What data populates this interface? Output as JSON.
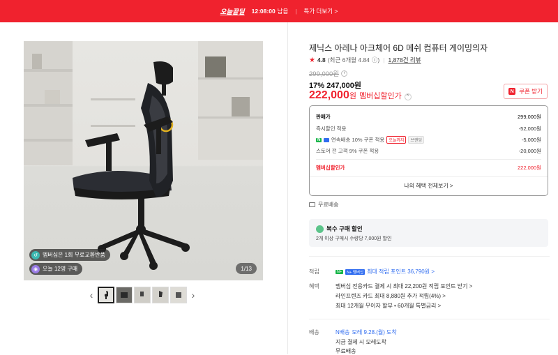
{
  "topbar": {
    "deal_label": "오늘끝딜",
    "time": "12:08:00",
    "remaining": "남음",
    "more": "특가 더보기 >"
  },
  "gallery": {
    "badge_1": "멤버십은 1회 무료교환반품",
    "badge_2": "오늘 12명 구매",
    "counter": "1/13",
    "thumb_count": 5
  },
  "product": {
    "title": "제닉스 아레나 아크체어 6D 메쉬 컴퓨터 게이밍의자",
    "rating": "4.8",
    "recent_rating": "(최근 6개월 4.84",
    "recent_close": ")",
    "reviews": "1,878건 리뷰",
    "original_price": "299,000원",
    "discount": "17%",
    "sale_price": "247,000원",
    "member_price": "222,000",
    "member_price_unit": "원",
    "member_label": "멤버십할인가",
    "coupon_button": "쿠폰 받기"
  },
  "price_box": {
    "head_label": "판매가",
    "head_value": "299,000원",
    "row1_label": "즉시할인 적용",
    "row1_value": "-52,000원",
    "row2_label": "연속배송 10% 쿠폰 적용",
    "row2_tag1": "오늘까지",
    "row2_tag2": "브랜딩",
    "row2_value": "-5,000원",
    "row3_label": "스토어 전 고객 9% 쿠폰 적용",
    "row3_value": "-20,000원",
    "total_label": "멤버십할인가",
    "total_value": "222,000원",
    "all_benefits": "나의 혜택 전체보기 >"
  },
  "shipping_free": "무료배송",
  "multi_buy": {
    "title": "복수 구매 할인",
    "desc": "2개 이상 구매시 수량당 7,000원 할인"
  },
  "points": {
    "label": "적립",
    "badge": "N+ 멤버십",
    "value": "최대 적립 포인트 36,790원 >"
  },
  "benefits": {
    "label": "혜택",
    "line1": "멤버십 전용카드 결제 시 최대 22,200원 적립 포인트 받기 >",
    "line2": "라인프렌즈 카드 최대 8,880원 추가 적립(4%) >",
    "line3": "최대 12개월 무이자 할부 • 60개월 특별금리 >"
  },
  "delivery": {
    "label": "배송",
    "badge": "N배송",
    "arrival": "모레 9.28.(월) 도착",
    "line2": "지금 결제 시 모레도착",
    "line3": "무료배송"
  },
  "colors": {
    "brand_red": "#f0222e",
    "link_blue": "#2f6cf0",
    "npay_green": "#19b64a"
  }
}
